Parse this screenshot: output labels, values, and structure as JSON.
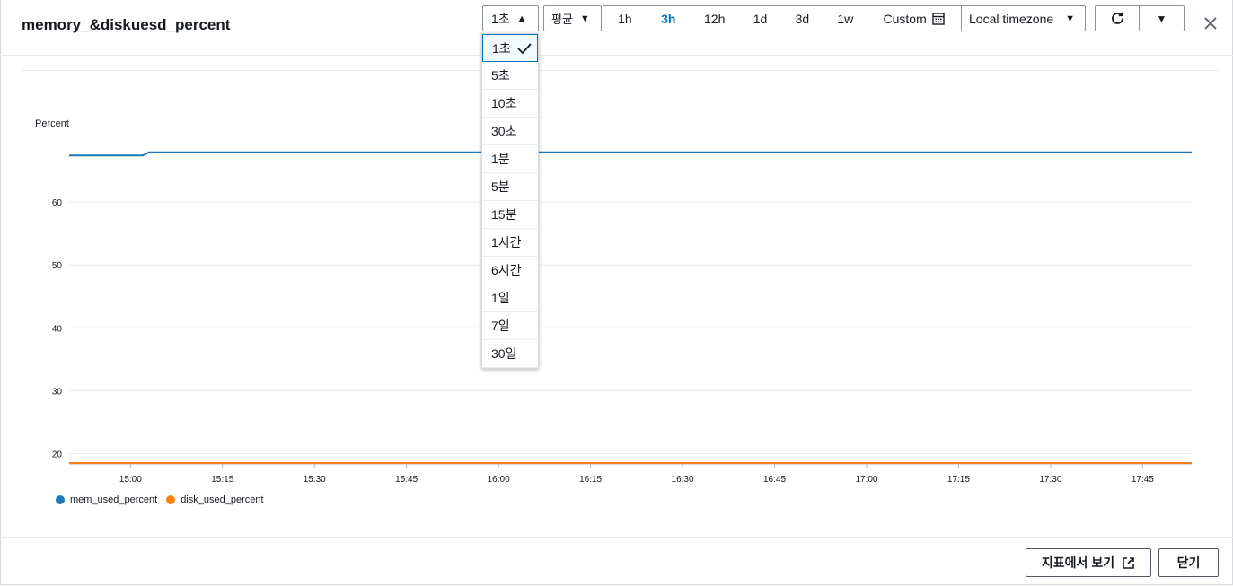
{
  "header": {
    "title": "memory_&diskuesd_percent"
  },
  "toolbar": {
    "period_label": "1초",
    "stat_label": "평균",
    "ranges": [
      "1h",
      "3h",
      "12h",
      "1d",
      "3d",
      "1w",
      "Custom"
    ],
    "active_range": "3h",
    "timezone_label": "Local timezone"
  },
  "period_menu": {
    "selected": "1초",
    "options": [
      "1초",
      "5초",
      "10초",
      "30초",
      "1분",
      "5분",
      "15분",
      "1시간",
      "6시간",
      "1일",
      "7일",
      "30일"
    ]
  },
  "colors": {
    "accent": "#0073bb",
    "mem": "#1f77b4",
    "disk": "#ff7f0e"
  },
  "chart_data": {
    "type": "line",
    "ylabel": "Percent",
    "y_ticks": [
      20,
      30,
      40,
      50,
      60
    ],
    "ylim": [
      18.5,
      71
    ],
    "x_ticks": [
      "15:00",
      "15:15",
      "15:30",
      "15:45",
      "16:00",
      "16:15",
      "16:30",
      "16:45",
      "17:00",
      "17:15",
      "17:30",
      "17:45"
    ],
    "x_minutes_start": "14:50",
    "x_minutes_end": "17:53",
    "grid": true,
    "series": [
      {
        "name": "mem_used_percent",
        "color": "#1f77b4",
        "points": [
          [
            "14:50",
            67.4
          ],
          [
            "15:02",
            67.4
          ],
          [
            "15:03",
            67.9
          ],
          [
            "17:53",
            67.9
          ]
        ]
      },
      {
        "name": "disk_used_percent",
        "color": "#ff7f0e",
        "points": [
          [
            "14:50",
            18.5
          ],
          [
            "17:53",
            18.5
          ]
        ]
      }
    ]
  },
  "legend": [
    "mem_used_percent",
    "disk_used_percent"
  ],
  "footer": {
    "view_metrics_label": "지표에서 보기",
    "close_label": "닫기"
  }
}
